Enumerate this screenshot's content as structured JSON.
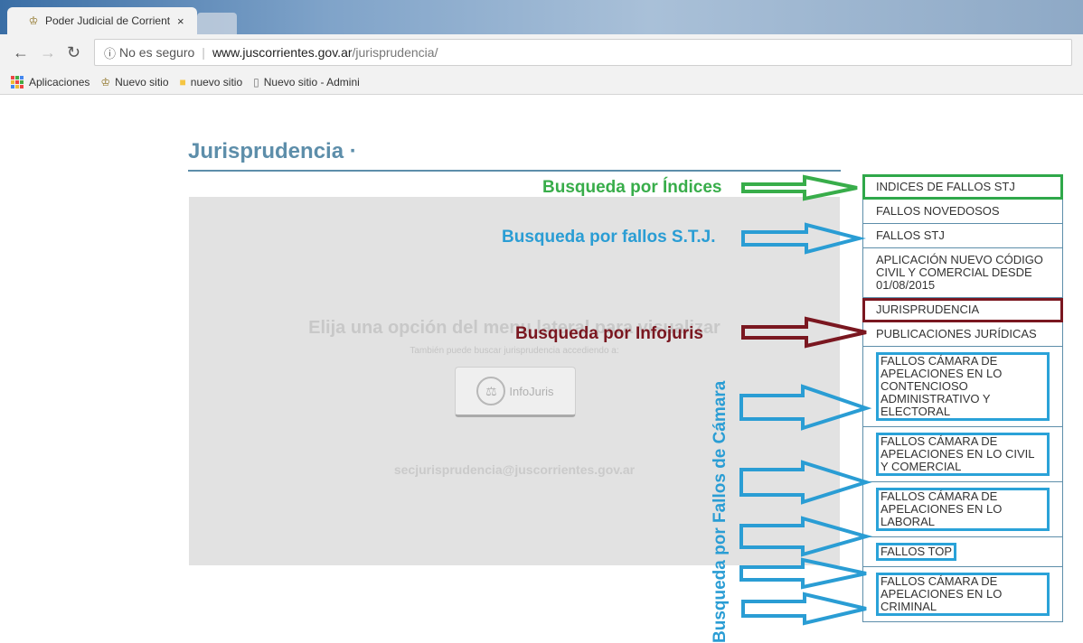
{
  "browser": {
    "tab_title": "Poder Judicial de Corrient",
    "tab_close": "×",
    "address": {
      "security": "No es seguro",
      "host": "www.juscorrientes.gov.ar",
      "path": "/jurisprudencia/"
    },
    "bookmarks": [
      "Aplicaciones",
      "Nuevo sitio",
      "nuevo sitio",
      "Nuevo sitio - Admini"
    ]
  },
  "page": {
    "title": "Jurisprudencia ·",
    "content": {
      "message": "Elija una opción del menu lateral para visualizar",
      "submessage": "También puede buscar jurisprudencia accediendo a:",
      "button_label": "InfoJuris",
      "email": "secjurisprudencia@juscorrientes.gov.ar"
    },
    "menu": [
      "INDICES DE FALLOS STJ",
      "FALLOS NOVEDOSOS",
      "FALLOS STJ",
      "APLICACIÓN NUEVO CÓDIGO CIVIL Y COMERCIAL DESDE 01/08/2015",
      "JURISPRUDENCIA",
      "PUBLICACIONES JURÍDICAS",
      "FALLOS CÁMARA DE APELACIONES EN LO CONTENCIOSO ADMINISTRATIVO Y ELECTORAL",
      "FALLOS CÁMARA DE APELACIONES EN LO CIVIL Y COMERCIAL",
      "FALLOS CÁMARA DE APELACIONES EN LO LABORAL",
      "FALLOS TOP",
      "FALLOS CÁMARA DE APELACIONES EN LO CRIMINAL"
    ]
  },
  "annotations": {
    "indices": "Busqueda por Índices",
    "fallos_stj": "Busqueda por fallos S.T.J.",
    "infojuris": "Busqueda por Infojuris",
    "camara": "Busqueda por Fallos de Cámara"
  },
  "colors": {
    "accent": "#5d8eaa",
    "green": "#38ad4a",
    "blue": "#2a9dd4",
    "maroon": "#7a1720"
  }
}
